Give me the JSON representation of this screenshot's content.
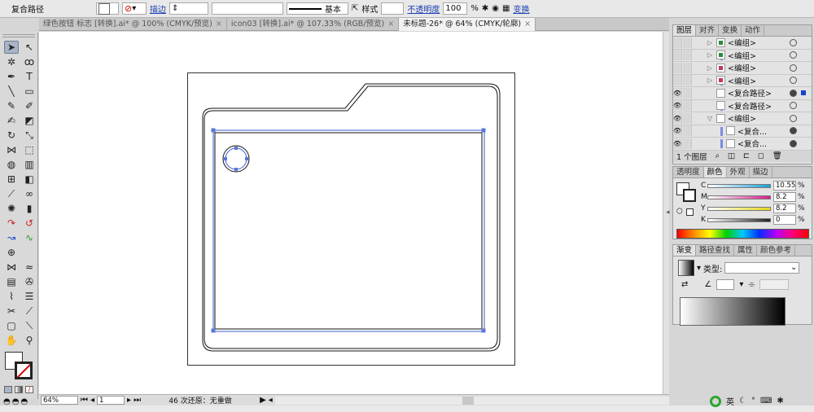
{
  "control_bar": {
    "object_type": "复合路径",
    "stroke_label": "描边",
    "stroke_weight": "基本",
    "style_label": "样式",
    "opacity_label": "不透明度",
    "opacity_value": "100",
    "opacity_unit": "%",
    "transform_label": "变换"
  },
  "doc_tabs": [
    {
      "label": "绿色按钮 标志 [转换].ai* @ 100% (CMYK/预览)",
      "close": "×"
    },
    {
      "label": "icon03 [转换].ai* @ 107.33% (RGB/预览)",
      "close": "×"
    },
    {
      "label": "未标题-26* @ 64% (CMYK/轮廓)",
      "close": "×"
    }
  ],
  "layers_panel": {
    "tabs": [
      "图层",
      "对齐",
      "变换",
      "动作"
    ],
    "rows": [
      {
        "label": "<编组>"
      },
      {
        "label": "<编组>"
      },
      {
        "label": "<编组>"
      },
      {
        "label": "<编组>"
      },
      {
        "label": "<复合路径>"
      },
      {
        "label": "<复合路径>"
      },
      {
        "label": "<编组>"
      },
      {
        "label": "<复合..."
      },
      {
        "label": "<复合..."
      }
    ],
    "footer": "1 个图层"
  },
  "color_panel": {
    "tabs": [
      "透明度",
      "颜色",
      "外观",
      "描边"
    ],
    "channels": [
      {
        "label": "C",
        "value": "10.55",
        "unit": "%",
        "color": "#1aa0d8"
      },
      {
        "label": "M",
        "value": "8.2",
        "unit": "%",
        "color": "#d81b8c"
      },
      {
        "label": "Y",
        "value": "8.2",
        "unit": "%",
        "color": "#e5d81a"
      },
      {
        "label": "K",
        "value": "0",
        "unit": "%",
        "color": "#222222"
      }
    ]
  },
  "gradient_panel": {
    "tabs": [
      "渐变",
      "路径查找",
      "属性",
      "颜色参考"
    ],
    "type_label": "类型:"
  },
  "status_bar": {
    "zoom": "64%",
    "artboard": "1",
    "message": "46 次还原：无重做"
  },
  "colors": {
    "accent": "#3b5bd6",
    "anchor": "#5a78d8"
  },
  "watermark": "英"
}
